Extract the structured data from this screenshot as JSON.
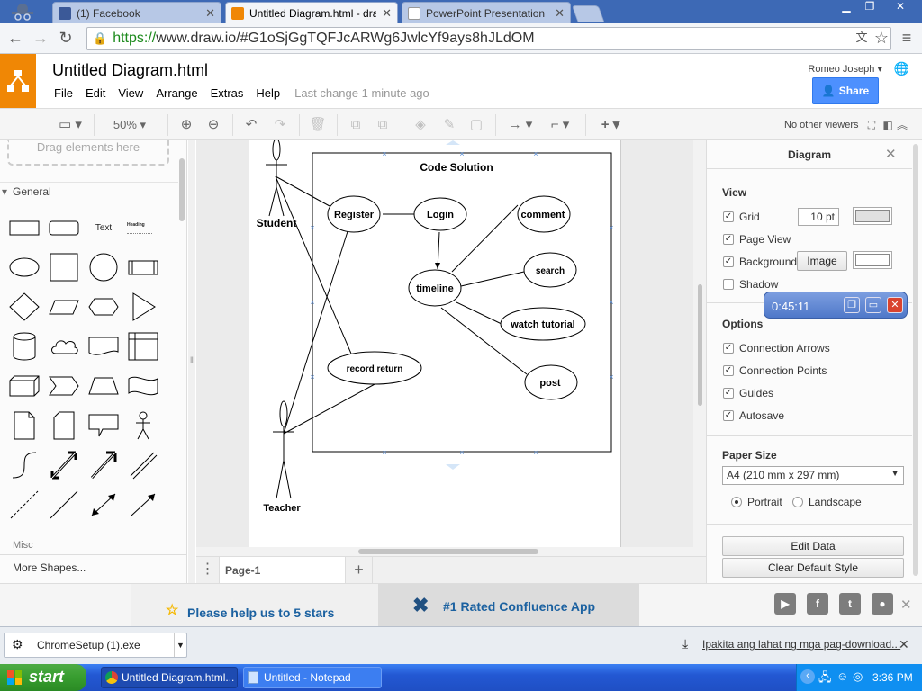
{
  "browser": {
    "tabs": [
      {
        "title": "(1) Facebook",
        "favicon_color": "#3b5998"
      },
      {
        "title": "Untitled Diagram.html - draw",
        "favicon_color": "#f08705"
      },
      {
        "title": "PowerPoint Presentation",
        "favicon_color": "#cccccc"
      }
    ],
    "url_scheme": "https://",
    "url_rest": "www.draw.io/#G1oSjGgTQFJcARWg6JwlcYf9ays8hJLdOM"
  },
  "app": {
    "doc_title": "Untitled Diagram.html",
    "menu": [
      "File",
      "Edit",
      "View",
      "Arrange",
      "Extras",
      "Help"
    ],
    "last_change": "Last change 1 minute ago",
    "user_name": "Romeo Joseph",
    "share_label": "Share",
    "accent": "#f08705",
    "share_color": "#4d90fe"
  },
  "toolbar": {
    "zoom": "50%",
    "viewers": "No other viewers"
  },
  "sidebar": {
    "drag_hint": "Drag elements here",
    "section_general": "General",
    "shape_text": "Text",
    "shape_heading": "Heading",
    "section_misc": "Misc",
    "more_shapes": "More Shapes..."
  },
  "diagram": {
    "title": "Code Solution",
    "actors": [
      "Student",
      "Teacher"
    ],
    "use_cases": [
      "Register",
      "Login",
      "comment",
      "search",
      "timeline",
      "watch tutorial",
      "record return",
      "post"
    ]
  },
  "pages": {
    "current": "Page-1"
  },
  "format_panel": {
    "title": "Diagram",
    "view_section": "View",
    "grid_label": "Grid",
    "grid_size": "10 pt",
    "page_view_label": "Page View",
    "background_label": "Background",
    "image_button": "Image",
    "shadow_label": "Shadow",
    "options_section": "Options",
    "options": [
      "Connection Arrows",
      "Connection Points",
      "Guides",
      "Autosave"
    ],
    "paper_size_section": "Paper Size",
    "paper_size_value": "A4 (210 mm x 297 mm)",
    "portrait_label": "Portrait",
    "landscape_label": "Landscape",
    "edit_data_button": "Edit Data",
    "clear_style_button": "Clear Default Style"
  },
  "timer": {
    "time": "0:45:11"
  },
  "promo": {
    "stars_text": "Please help us to 5 stars",
    "confluence_text": "#1 Rated Confluence App"
  },
  "downloads": {
    "file_name": "ChromeSetup (1).exe",
    "show_all": "Ipakita ang lahat ng mga pag-download..."
  },
  "taskbar": {
    "start_label": "start",
    "items": [
      "Untitled Diagram.html...",
      "Untitled - Notepad"
    ],
    "clock": "3:36 PM"
  }
}
